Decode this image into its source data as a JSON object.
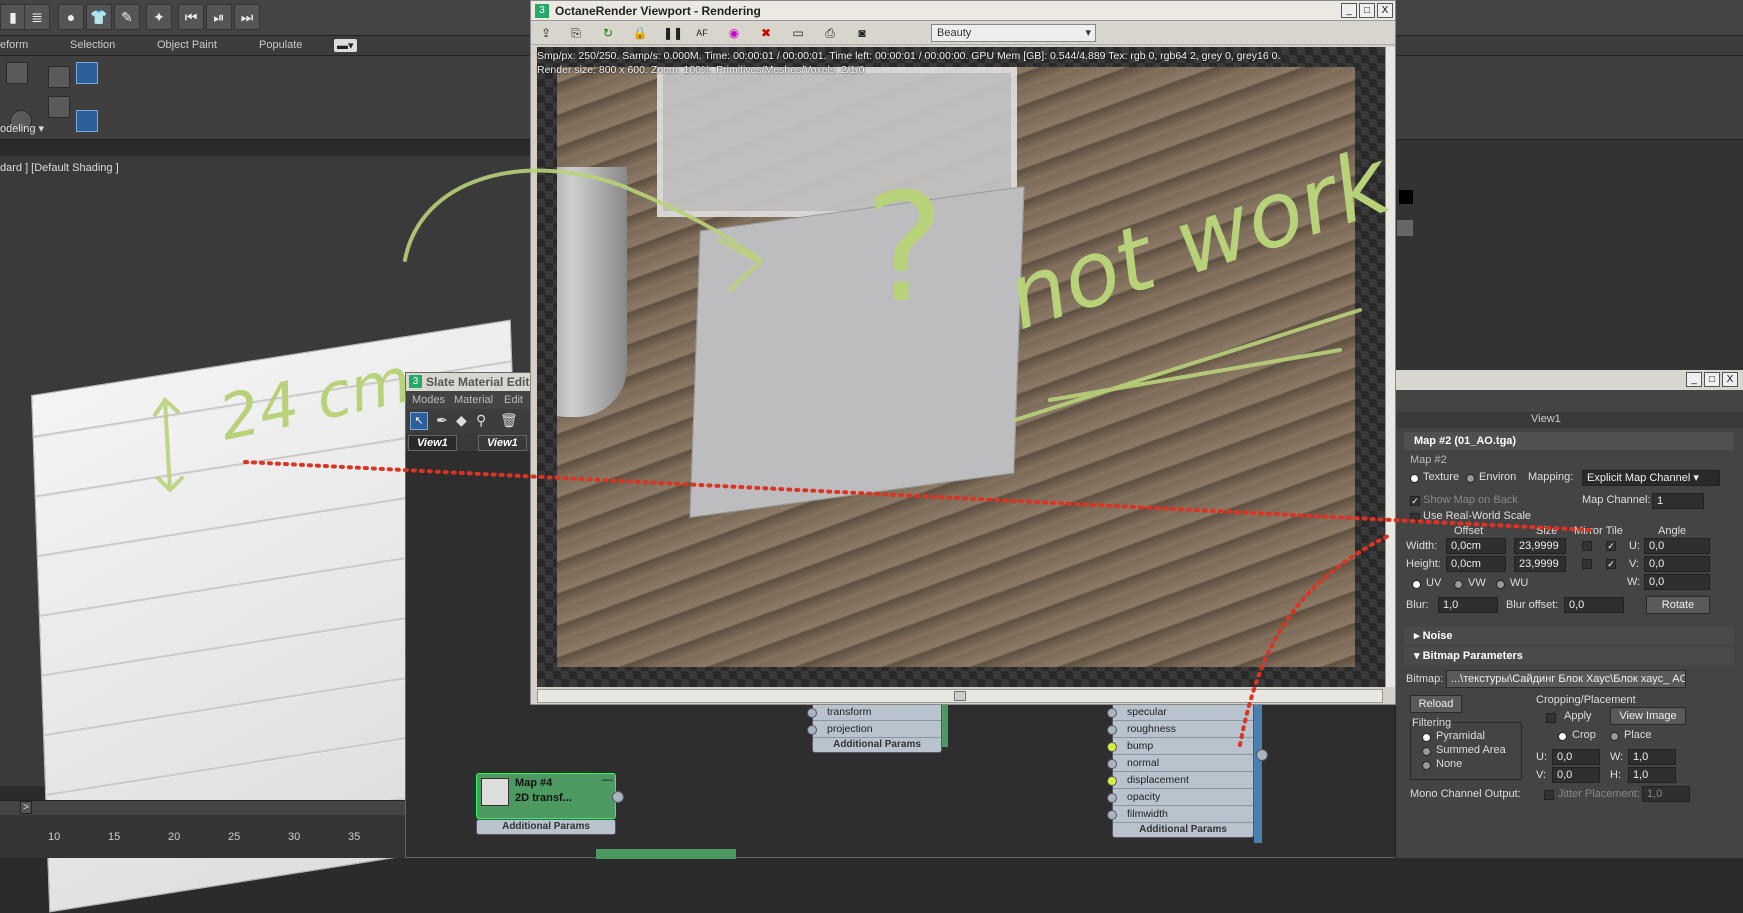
{
  "ribbon_tabs": [
    "eform",
    "Selection",
    "Object Paint",
    "Populate"
  ],
  "ribbon_dropdown": "odeling",
  "viewport_label": "dard ] [Default Shading ]",
  "timeline_ticks": [
    "10",
    "15",
    "20",
    "25",
    "30",
    "35"
  ],
  "timeline_btn": ">",
  "octane": {
    "title": "OctaneRender Viewport - Rendering",
    "pass": "Beauty",
    "stats_line1": "Smp/px: 250/250.   Samp/s: 0.000M.   Time: 00:00:01 / 00:00:01.   Time left: 00:00:01 / 00:00:00.   GPU Mem [GB]: 0.544/4.889   Tex: rgb 0, rgb64 2, grey 0, grey16 0.",
    "stats_line2": "Render size: 800 x 600.   Zoom: 100%.   Primitives/Meshes/Voxels: 2/1/0",
    "win_min": "_",
    "win_max": "□",
    "win_close": "X"
  },
  "slate": {
    "title": "Slate Material Edit",
    "menu": [
      "Modes",
      "Material",
      "Edit"
    ],
    "tab1": "View1",
    "tab2": "View1",
    "node_mid_rows": [
      "transform",
      "projection"
    ],
    "node_mid_footer": "Additional Params",
    "node_main_rows": [
      "specular",
      "roughness",
      "bump",
      "normal",
      "displacement",
      "opacity",
      "filmwidth"
    ],
    "node_main_footer": "Additional Params",
    "map4_title": "Map #4",
    "map4_sub": "2D transf...",
    "map4_footer": "Additional Params"
  },
  "right_panel": {
    "view_label": "View1",
    "header": "Map #2 (01_AO.tga)",
    "name": "Map #2",
    "texture": "Texture",
    "environ": "Environ",
    "mapping_label": "Mapping:",
    "mapping_value": "Explicit Map Channel",
    "show_map_back": "Show Map on Back",
    "map_channel_label": "Map Channel:",
    "map_channel_value": "1",
    "use_real_world": "Use Real-World Scale",
    "col_offset": "Offset",
    "col_size": "Size",
    "col_mirror_tile": "Mirror Tile",
    "col_angle": "Angle",
    "width_label": "Width:",
    "width_offset": "0,0cm",
    "width_size": "23,9999",
    "height_label": "Height:",
    "height_offset": "0,0cm",
    "height_size": "23,9999",
    "u_label": "U:",
    "u_value": "0,0",
    "v_label": "V:",
    "v_value": "0,0",
    "w_label": "W:",
    "w_value": "0,0",
    "uv": "UV",
    "vw": "VW",
    "wu": "WU",
    "blur_label": "Blur:",
    "blur_value": "1,0",
    "blur_offset_label": "Blur offset:",
    "blur_offset_value": "0,0",
    "rotate": "Rotate",
    "noise": "Noise",
    "bitmap_params": "Bitmap Parameters",
    "bitmap_label": "Bitmap:",
    "bitmap_path": "...\\текстуры\\Сайдинг Блок Хаус\\Блок хаус_ AO.psd",
    "reload": "Reload",
    "cropping": "Cropping/Placement",
    "apply": "Apply",
    "view_image": "View Image",
    "crop": "Crop",
    "place": "Place",
    "filtering": "Filtering",
    "pyramidal": "Pyramidal",
    "summed_area": "Summed Area",
    "none": "None",
    "cu_label": "U:",
    "cu_value": "0,0",
    "cw_label": "W:",
    "cw_value": "1,0",
    "cv_label": "V:",
    "cv_value": "0,0",
    "ch_label": "H:",
    "ch_value": "1,0",
    "mono_channel": "Mono Channel Output:",
    "jitter": "Jitter Placement:",
    "jitter_value": "1,0"
  },
  "annotations": {
    "dimension": "24 cm",
    "question": "?",
    "not_work": "not work"
  }
}
